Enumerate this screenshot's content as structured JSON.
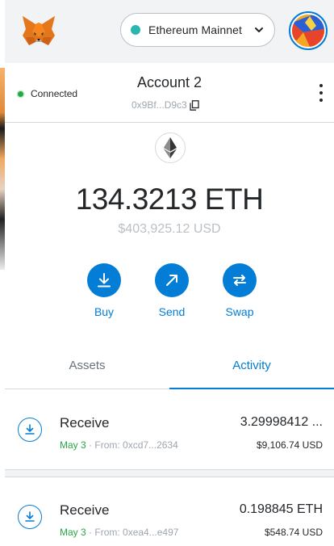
{
  "network": {
    "name": "Ethereum Mainnet",
    "color": "#29b6af"
  },
  "account": {
    "status": "Connected",
    "name": "Account 2",
    "address": "0x9Bf...D9c3"
  },
  "balance": {
    "amount": "134.3213 ETH",
    "fiat": "$403,925.12 USD"
  },
  "actions": [
    {
      "label": "Buy",
      "icon": "download-icon"
    },
    {
      "label": "Send",
      "icon": "arrow-up-right-icon"
    },
    {
      "label": "Swap",
      "icon": "swap-icon"
    }
  ],
  "tabs": [
    {
      "label": "Assets",
      "active": false
    },
    {
      "label": "Activity",
      "active": true
    }
  ],
  "transactions": [
    {
      "type": "Receive",
      "date": "May 3",
      "from": "From: 0xcd7...2634",
      "amount": "3.29998412 ...",
      "fiat": "$9,106.74 USD"
    },
    {
      "type": "Receive",
      "date": "May 3",
      "from": "From: 0xea4...e497",
      "amount": "0.198845 ETH",
      "fiat": "$548.74 USD"
    }
  ],
  "colors": {
    "accent": "#037dd6",
    "success": "#28a745",
    "muted": "#9fa6ae"
  }
}
